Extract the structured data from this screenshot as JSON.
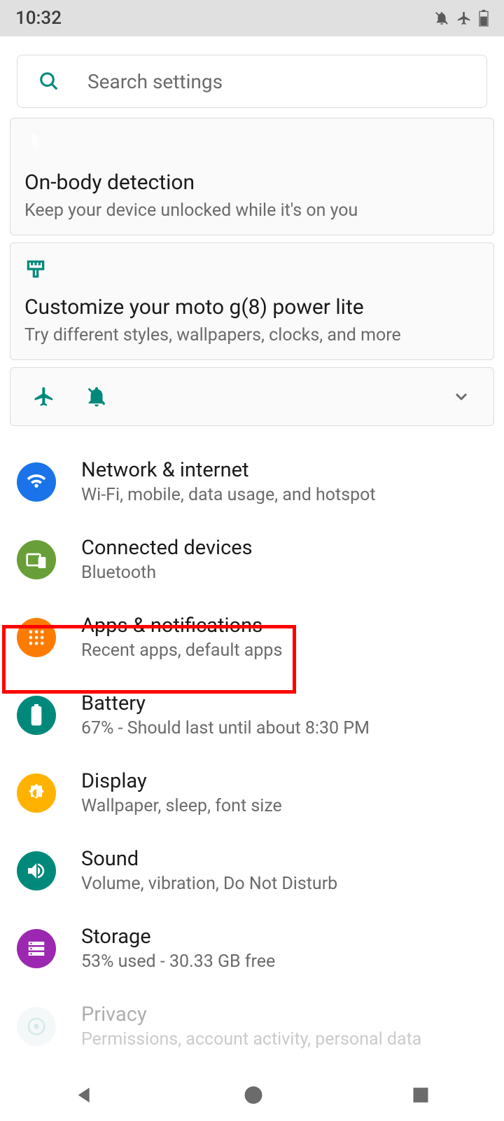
{
  "status": {
    "time": "10:32"
  },
  "search": {
    "placeholder": "Search settings"
  },
  "cards": {
    "onbody": {
      "title": "On-body detection",
      "subtitle": "Keep your device unlocked while it's on you"
    },
    "customize": {
      "title": "Customize your moto g(8) power lite",
      "subtitle": "Try different styles, wallpapers, clocks, and more"
    }
  },
  "items": [
    {
      "title": "Network & internet",
      "subtitle": "Wi-Fi, mobile, data usage, and hotspot"
    },
    {
      "title": "Connected devices",
      "subtitle": "Bluetooth"
    },
    {
      "title": "Apps & notifications",
      "subtitle": "Recent apps, default apps"
    },
    {
      "title": "Battery",
      "subtitle": "67% - Should last until about 8:30 PM"
    },
    {
      "title": "Display",
      "subtitle": "Wallpaper, sleep, font size"
    },
    {
      "title": "Sound",
      "subtitle": "Volume, vibration, Do Not Disturb"
    },
    {
      "title": "Storage",
      "subtitle": "53% used - 30.33 GB free"
    },
    {
      "title": "Privacy",
      "subtitle": "Permissions, account activity, personal data"
    }
  ],
  "colors": {
    "accent": "#00897b"
  }
}
